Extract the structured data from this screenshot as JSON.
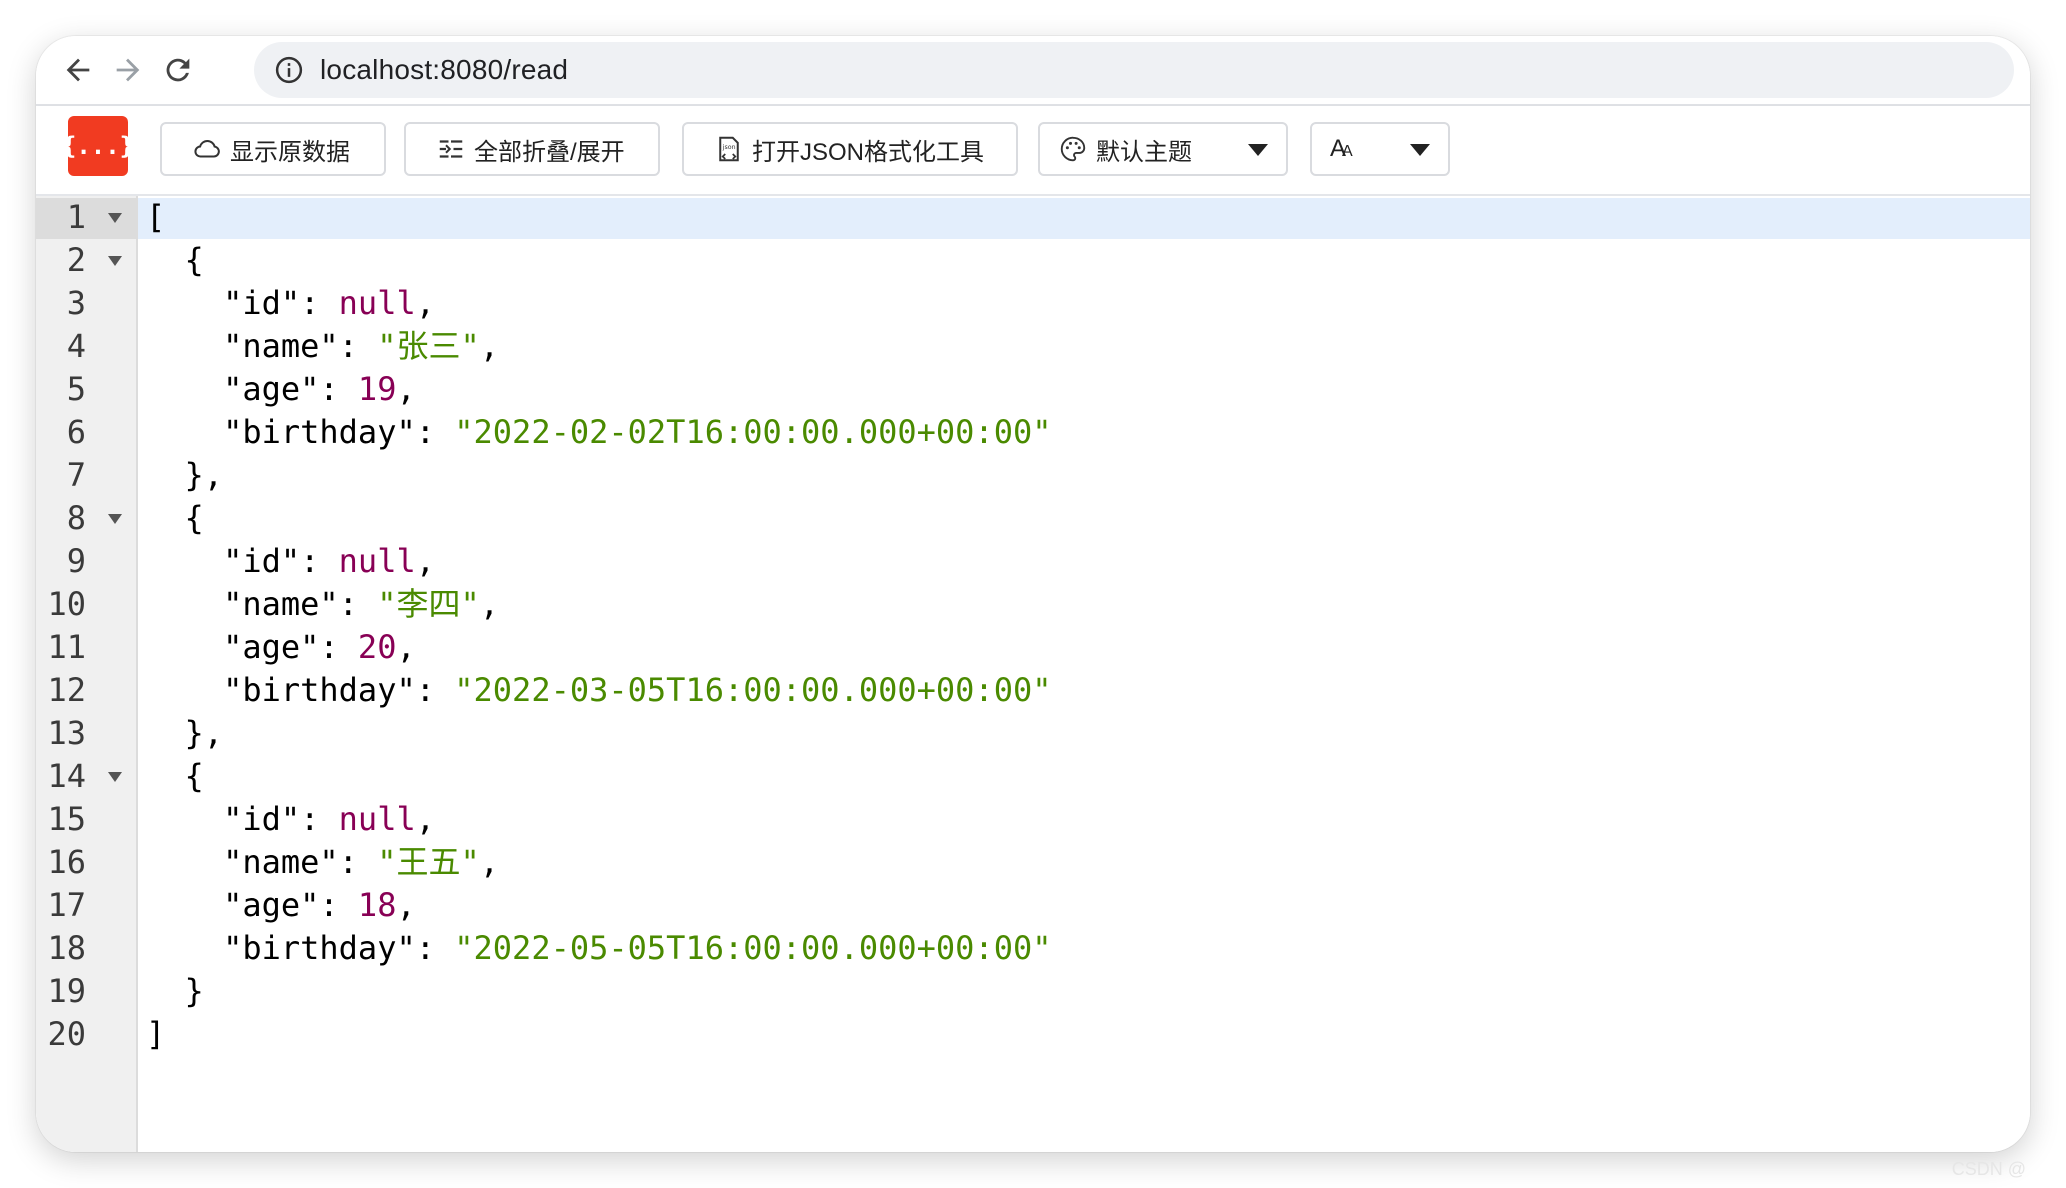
{
  "browser": {
    "url": "localhost:8080/read",
    "nav": {
      "back_icon": "arrow-left-icon",
      "forward_icon": "arrow-right-icon",
      "reload_icon": "reload-icon"
    }
  },
  "toolbar": {
    "logo_text": "{...}",
    "raw_label": "显示原数据",
    "fold_label": "全部折叠/展开",
    "tool_label": "打开JSON格式化工具",
    "theme_label": "默认主题",
    "font_label": "AA",
    "accent": "#f13b21"
  },
  "editor": {
    "line_numbers": [
      "1",
      "2",
      "3",
      "4",
      "5",
      "6",
      "7",
      "8",
      "9",
      "10",
      "11",
      "12",
      "13",
      "14",
      "15",
      "16",
      "17",
      "18",
      "19",
      "20"
    ],
    "folded_lines": [
      1,
      2,
      8,
      14
    ],
    "records": [
      {
        "id": "null",
        "name": "\"张三\"",
        "age": "19",
        "birthday": "\"2022-02-02T16:00:00.000+00:00\""
      },
      {
        "id": "null",
        "name": "\"李四\"",
        "age": "20",
        "birthday": "\"2022-03-05T16:00:00.000+00:00\""
      },
      {
        "id": "null",
        "name": "\"王五\"",
        "age": "18",
        "birthday": "\"2022-05-05T16:00:00.000+00:00\""
      }
    ],
    "keys": {
      "id": "\"id\"",
      "name": "\"name\"",
      "age": "\"age\"",
      "birthday": "\"birthday\""
    },
    "colors": {
      "keyword": "#880055",
      "string": "#4a8a00",
      "number": "#880055"
    }
  },
  "watermark": "CSDN @"
}
